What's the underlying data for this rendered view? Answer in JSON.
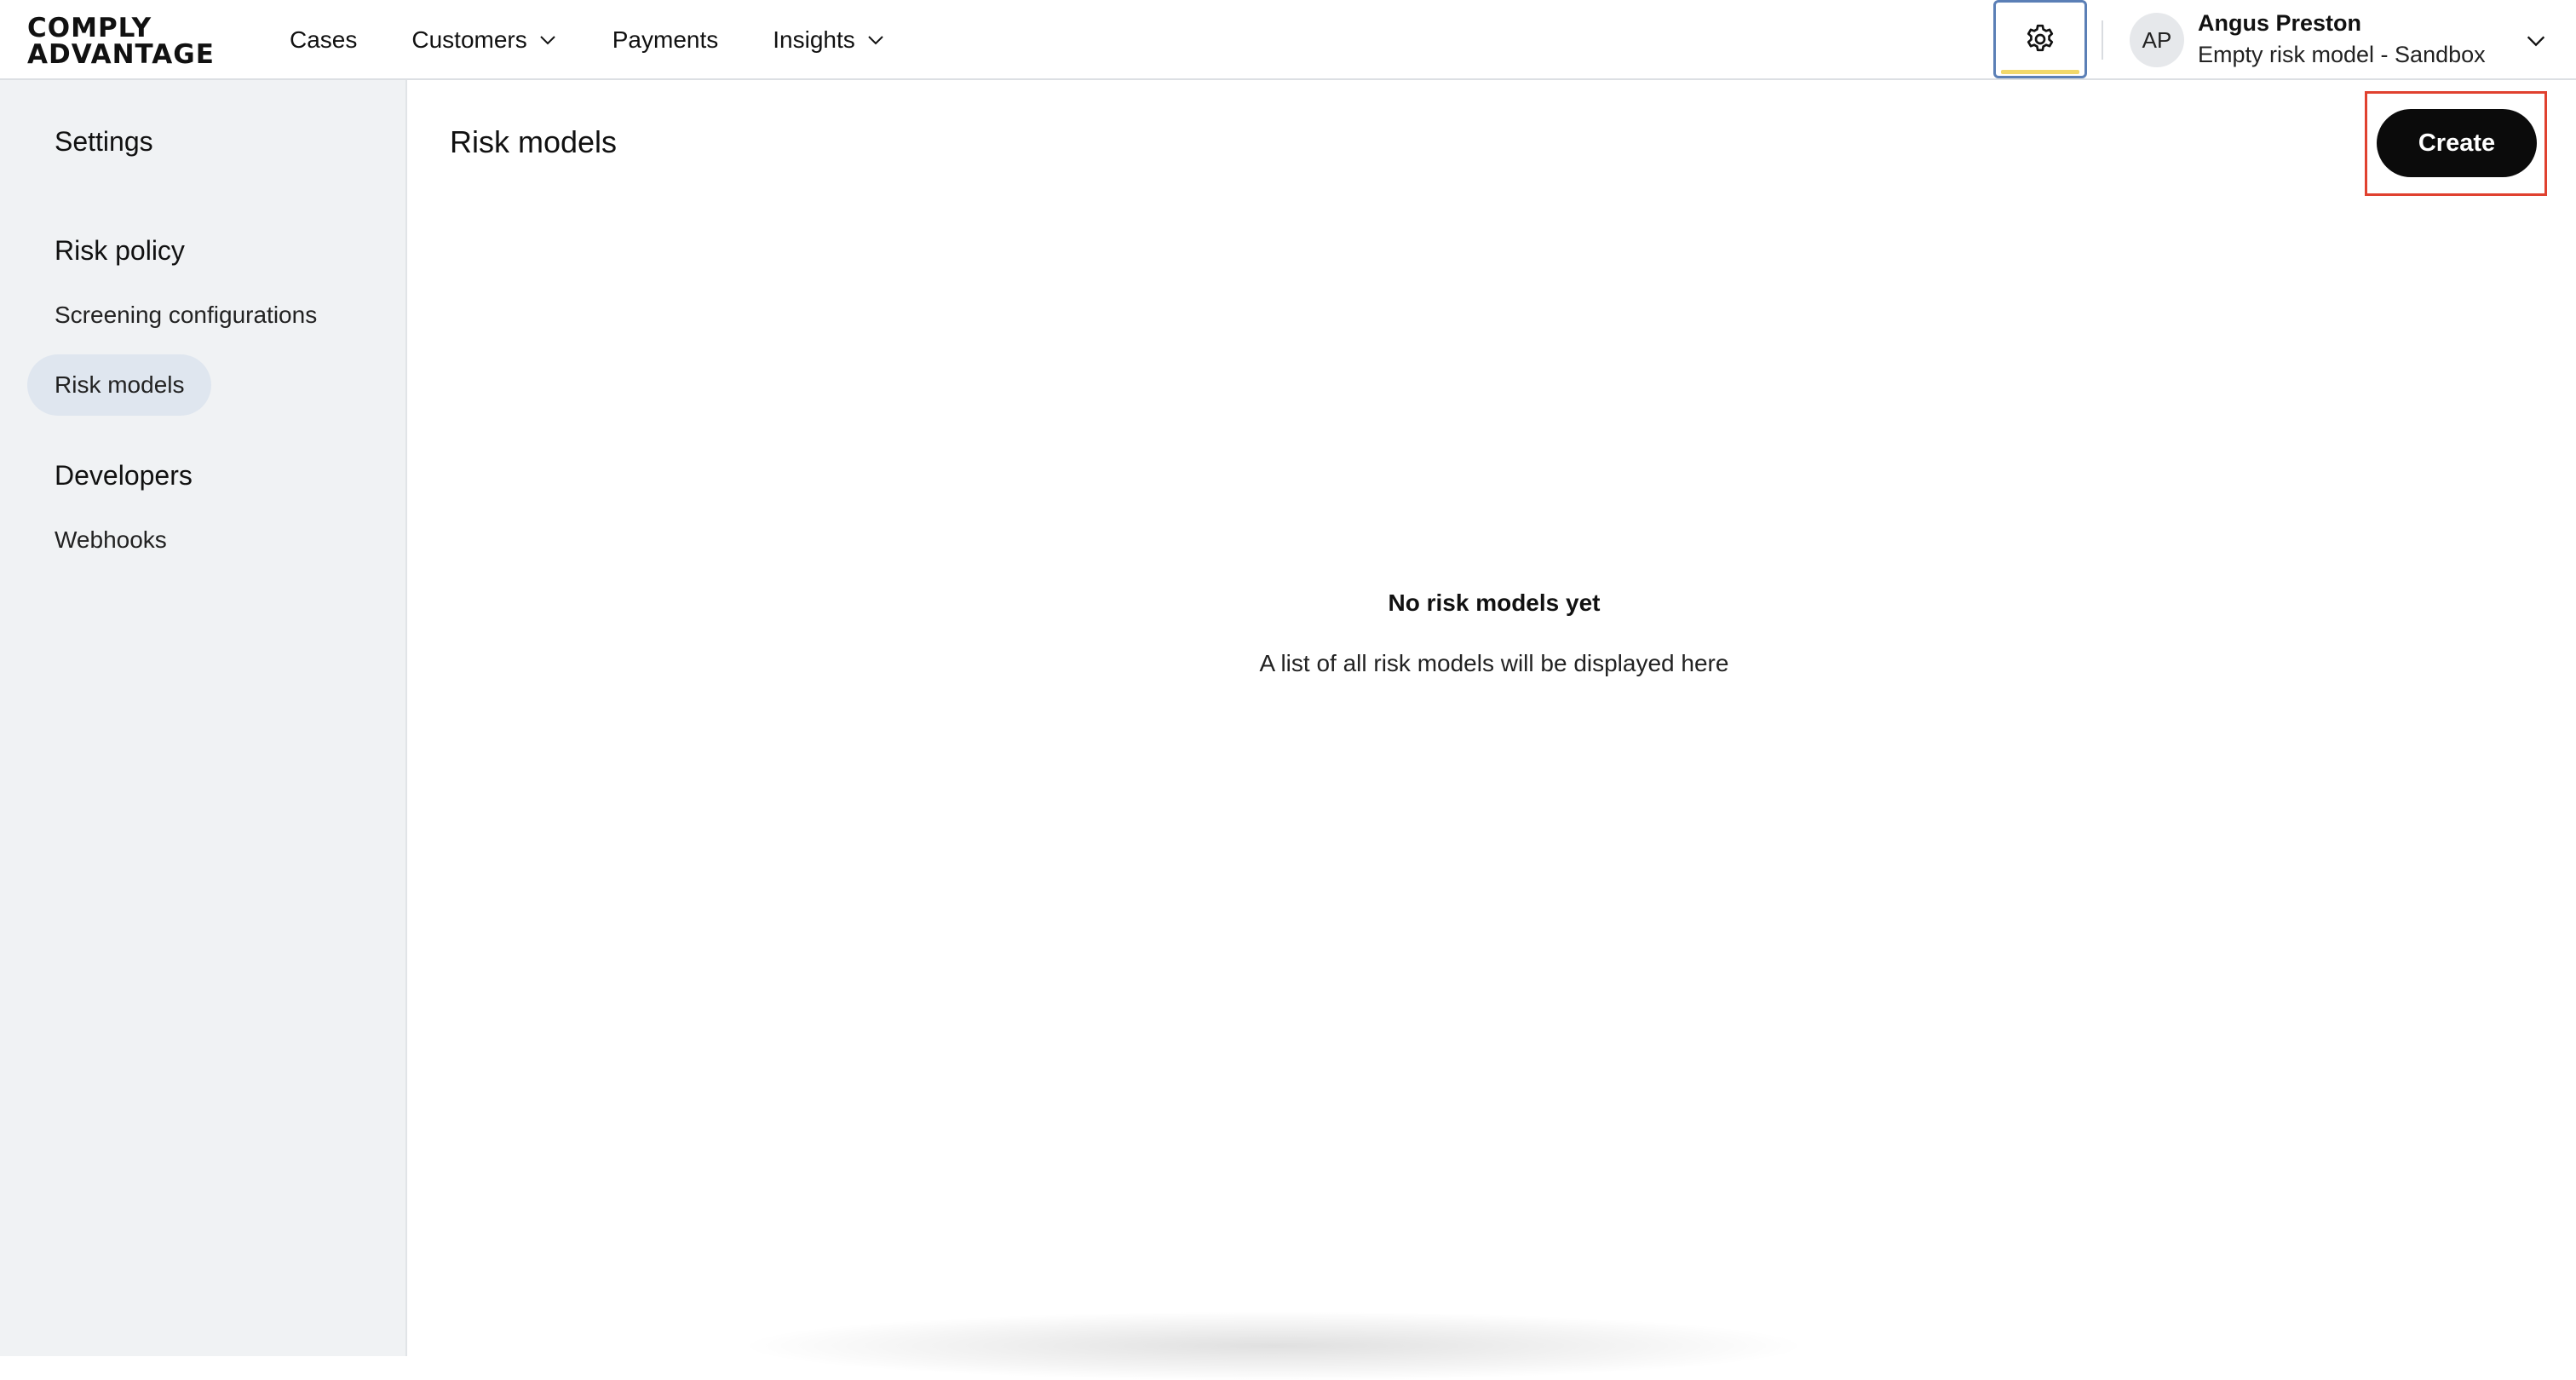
{
  "brand": {
    "line1": "COMPLY",
    "line2": "ADVANTAGE"
  },
  "nav": {
    "cases": "Cases",
    "customers": "Customers",
    "payments": "Payments",
    "insights": "Insights"
  },
  "user": {
    "initials": "AP",
    "name": "Angus Preston",
    "environment": "Empty risk model - Sandbox"
  },
  "sidebar": {
    "title": "Settings",
    "sections": [
      {
        "heading": "Risk policy",
        "items": [
          "Screening configurations",
          "Risk models"
        ]
      },
      {
        "heading": "Developers",
        "items": [
          "Webhooks"
        ]
      }
    ],
    "active_item": "Risk models"
  },
  "main": {
    "title": "Risk models",
    "create_label": "Create",
    "empty_title": "No risk models yet",
    "empty_subtitle": "A list of all risk models will be displayed here"
  },
  "colors": {
    "accent_outline": "#e0412f",
    "active_item_bg": "#dfe6ef",
    "gear_focus_border": "#5b7fb6",
    "gear_focus_underline": "#f1d86b"
  },
  "icons": {
    "settings": "gear-icon",
    "dropdown": "chevron-down-icon"
  }
}
